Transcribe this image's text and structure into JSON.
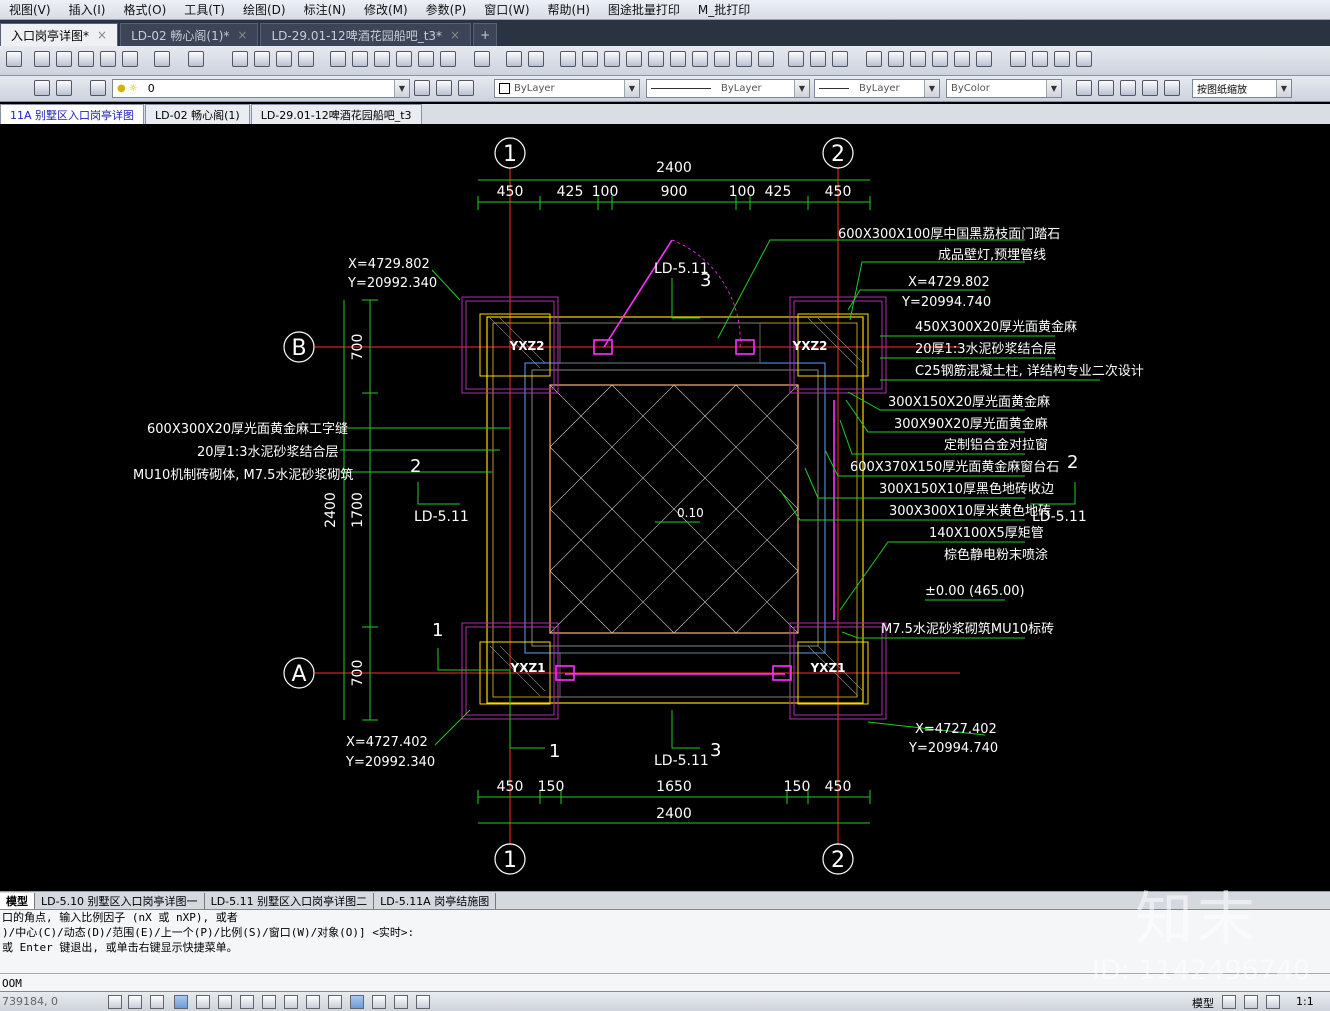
{
  "menu": [
    "视图(V)",
    "插入(I)",
    "格式(O)",
    "工具(T)",
    "绘图(D)",
    "标注(N)",
    "修改(M)",
    "参数(P)",
    "窗口(W)",
    "帮助(H)",
    "图途批量打印",
    "M_批打印"
  ],
  "file_tabs": [
    {
      "label": "入口岗亭详图*",
      "active": true
    },
    {
      "label": "LD-02 畅心阁(1)*",
      "active": false
    },
    {
      "label": "LD-29.01-12啤酒花园船吧_t3*",
      "active": false
    }
  ],
  "toolbar": {
    "layer_value": "0",
    "color": "ByLayer",
    "linetype": "ByLayer",
    "lineweight": "ByLayer",
    "plotstyle": "ByColor",
    "scale": "按图纸缩放"
  },
  "layout_tabs": [
    {
      "label": "11A 别墅区入口岗亭详图",
      "active": true
    },
    {
      "label": "LD-02 畅心阁(1)",
      "active": false
    },
    {
      "label": "LD-29.01-12啤酒花园船吧_t3",
      "active": false
    }
  ],
  "drawing": {
    "grid_top": [
      "1",
      "2"
    ],
    "grid_bottom": [
      "1",
      "2"
    ],
    "grid_left": [
      "B",
      "A"
    ],
    "dim_top_total": "2400",
    "dim_top": [
      "450",
      "425",
      "100",
      "900",
      "100",
      "425",
      "450"
    ],
    "dim_bottom": [
      "450",
      "150",
      "1650",
      "150",
      "450"
    ],
    "dim_bottom_total": "2400",
    "dim_left": [
      "700",
      "1700",
      "700"
    ],
    "dim_left_total": "2400",
    "columns": [
      "YXZ2",
      "YXZ2",
      "YXZ1",
      "YXZ1"
    ],
    "coords": {
      "tl_x": "X=4729.802",
      "tl_y": "Y=20992.340",
      "tr_x": "X=4729.802",
      "tr_y": "Y=20994.740",
      "bl_x": "X=4727.402",
      "bl_y": "Y=20992.340",
      "br_x": "X=4727.402",
      "br_y": "Y=20994.740"
    },
    "section_refs": {
      "top_num": "3",
      "top_ref": "LD-5.11",
      "bottom_num": "3",
      "bottom_ref": "LD-5.11",
      "left_num": "2",
      "left_ref": "LD-5.11",
      "right_num": "2",
      "right_ref": "LD-5.11",
      "bl_num_a": "1",
      "bl_num_b": "1"
    },
    "level_center": "0.10",
    "level_right": "±0.00 (465.00)",
    "notes_right": [
      "600X300X100厚中国黑荔枝面门踏石",
      "成品壁灯,预埋管线",
      "450X300X20厚光面黄金麻",
      "20厚1:3水泥砂浆结合层",
      "C25钢筋混凝土柱, 详结构专业二次设计",
      "300X150X20厚光面黄金麻",
      "300X90X20厚光面黄金麻",
      "定制铝合金对拉窗",
      "600X370X150厚光面黄金麻窗台石",
      "300X150X10厚黑色地砖收边",
      "300X300X10厚米黄色地砖",
      "140X100X5厚矩管",
      "棕色静电粉末喷涂",
      "M7.5水泥砂浆砌筑MU10标砖"
    ],
    "notes_left": [
      "600X300X20厚光面黄金麻工字缝",
      "20厚1:3水泥砂浆结合层",
      "MU10机制砖砌体, M7.5水泥砂浆砌筑"
    ]
  },
  "sheet_tabs": [
    "模型",
    "LD-5.10 别墅区入口岗亭详图一",
    "LD-5.11 别墅区入口岗亭详图二",
    "LD-5.11A 岗亭结施图"
  ],
  "command": {
    "line1": "口的角点, 输入比例因子 (nX 或 nXP), 或者",
    "line2": ")/中心(C)/动态(D)/范围(E)/上一个(P)/比例(S)/窗口(W)/对象(O)] <实时>:",
    "line3": "或 Enter 键退出, 或单击右键显示快捷菜单。",
    "input": "OOM"
  },
  "status": {
    "coords": "739184, 0",
    "model": "模型",
    "scale": "1:1"
  },
  "watermark": {
    "brand": "知末",
    "id": "ID: 1142496740"
  }
}
